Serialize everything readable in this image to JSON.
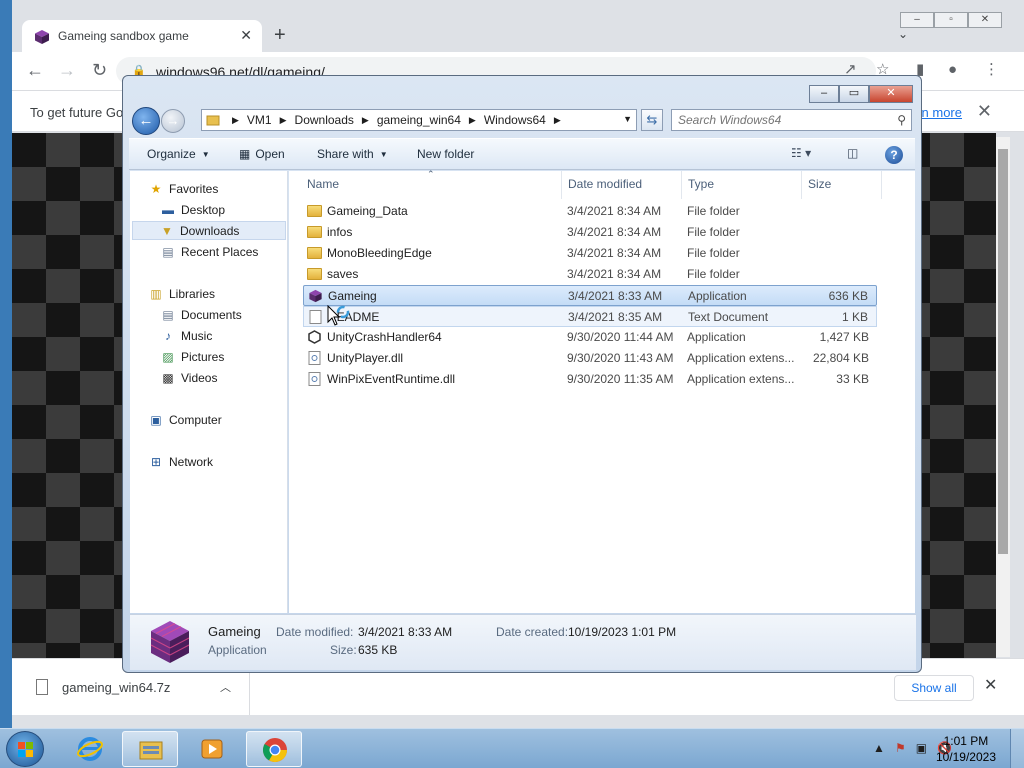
{
  "browser": {
    "tab_title": "Gameing sandbox game",
    "url": "windows96.net/dl/gameing/",
    "infobar_text": "To get future Go",
    "infobar_link": "n more"
  },
  "explorer": {
    "breadcrumb": [
      "VM1",
      "Downloads",
      "gameing_win64",
      "Windows64"
    ],
    "search_placeholder": "Search Windows64",
    "commands": {
      "organize": "Organize",
      "open": "Open",
      "share_with": "Share with",
      "new_folder": "New folder"
    },
    "nav": {
      "favorites": "Favorites",
      "desktop": "Desktop",
      "downloads": "Downloads",
      "recent_places": "Recent Places",
      "libraries": "Libraries",
      "documents": "Documents",
      "music": "Music",
      "pictures": "Pictures",
      "videos": "Videos",
      "computer": "Computer",
      "network": "Network"
    },
    "columns": {
      "name": "Name",
      "date": "Date modified",
      "type": "Type",
      "size": "Size"
    },
    "files": [
      {
        "name": "Gameing_Data",
        "date": "3/4/2021 8:34 AM",
        "type": "File folder",
        "size": "",
        "icon": "folder-icon"
      },
      {
        "name": "infos",
        "date": "3/4/2021 8:34 AM",
        "type": "File folder",
        "size": "",
        "icon": "folder-icon"
      },
      {
        "name": "MonoBleedingEdge",
        "date": "3/4/2021 8:34 AM",
        "type": "File folder",
        "size": "",
        "icon": "folder-icon"
      },
      {
        "name": "saves",
        "date": "3/4/2021 8:34 AM",
        "type": "File folder",
        "size": "",
        "icon": "folder-icon"
      },
      {
        "name": "Gameing",
        "date": "3/4/2021 8:33 AM",
        "type": "Application",
        "size": "636 KB",
        "icon": "app-cube-icon"
      },
      {
        "name": "README",
        "date": "3/4/2021 8:35 AM",
        "type": "Text Document",
        "size": "1 KB",
        "icon": "text-file-icon"
      },
      {
        "name": "UnityCrashHandler64",
        "date": "9/30/2020 11:44 AM",
        "type": "Application",
        "size": "1,427 KB",
        "icon": "unity-icon"
      },
      {
        "name": "UnityPlayer.dll",
        "date": "9/30/2020 11:43 AM",
        "type": "Application extens...",
        "size": "22,804 KB",
        "icon": "dll-icon"
      },
      {
        "name": "WinPixEventRuntime.dll",
        "date": "9/30/2020 11:35 AM",
        "type": "Application extens...",
        "size": "33 KB",
        "icon": "dll-icon"
      }
    ],
    "details": {
      "name": "Gameing",
      "kind": "Application",
      "date_modified_label": "Date modified:",
      "date_modified": "3/4/2021 8:33 AM",
      "size_label": "Size:",
      "size": "635 KB",
      "date_created_label": "Date created:",
      "date_created": "10/19/2023 1:01 PM"
    }
  },
  "downloads_bar": {
    "file": "gameing_win64.7z",
    "show_all": "Show all"
  },
  "taskbar": {
    "time": "1:01 PM",
    "date": "10/19/2023"
  },
  "colors": {
    "chrome_bg": "#dee1e6",
    "link": "#1a73e8",
    "taskbar": "#7ba7d1",
    "selection": "#c4dcf6"
  }
}
